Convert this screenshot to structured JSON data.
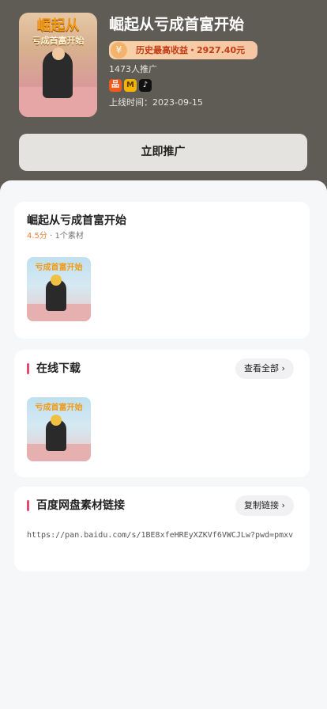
{
  "hero": {
    "title": "崛起从亏成首富开始",
    "cover_title": "崛起从",
    "cover_sub": "亏成首富开始",
    "badge_icon": "coin-icon",
    "badge_text": "历史最高收益・2927.40元",
    "promote_count": "1473人推广",
    "platforms": [
      {
        "name": "platform-a-icon",
        "glyph": "品"
      },
      {
        "name": "platform-b-icon",
        "glyph": "M"
      },
      {
        "name": "tiktok-icon",
        "glyph": "♪"
      }
    ],
    "online_date": "上线时间：2023-09-15",
    "promote_button": "立即推广"
  },
  "detail": {
    "title": "崛起从亏成首富开始",
    "score": "4.5分",
    "separator": " · ",
    "material_count": "1个素材",
    "thumb_title": "亏成首富开始"
  },
  "download": {
    "title": "在线下载",
    "view_all": "查看全部 ›",
    "thumb_title": "亏成首富开始"
  },
  "baidu": {
    "title": "百度网盘素材链接",
    "copy_button": "复制链接 ›",
    "link": "https://pan.baidu.com/s/1BE8xfeHREyXZKVf6VWCJLw?pwd=pmxv"
  },
  "colors": {
    "hero_bg": "#5f5c56",
    "accent_bar": "#e8486e",
    "score": "#e5803a",
    "badge_text": "#c23b16"
  }
}
